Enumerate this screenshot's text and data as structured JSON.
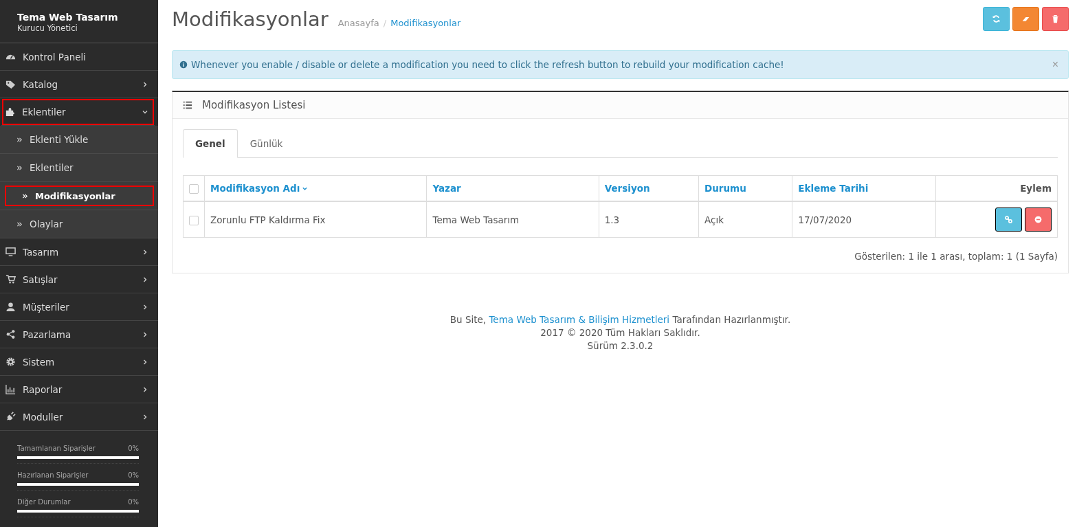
{
  "profile": {
    "name": "Tema Web Tasarım",
    "role": "Kurucu Yönetici"
  },
  "menu": [
    {
      "label": "Kontrol Paneli",
      "highlighted": false
    },
    {
      "label": "Katalog",
      "expanded": false,
      "highlighted": false
    },
    {
      "label": "Eklentiler",
      "expanded": true,
      "highlighted": true,
      "children": [
        {
          "label": "Eklenti Yükle",
          "selected": false,
          "highlighted": false
        },
        {
          "label": "Eklentiler",
          "selected": false,
          "highlighted": false
        },
        {
          "label": "Modifikasyonlar",
          "selected": true,
          "highlighted": true
        },
        {
          "label": "Olaylar",
          "selected": false,
          "highlighted": false
        }
      ]
    },
    {
      "label": "Tasarım",
      "expanded": false,
      "highlighted": false
    },
    {
      "label": "Satışlar",
      "expanded": false,
      "highlighted": false
    },
    {
      "label": "Müşteriler",
      "expanded": false,
      "highlighted": false
    },
    {
      "label": "Pazarlama",
      "expanded": false,
      "highlighted": false
    },
    {
      "label": "Sistem",
      "expanded": false,
      "highlighted": false
    },
    {
      "label": "Raporlar",
      "expanded": false,
      "highlighted": false
    },
    {
      "label": "Moduller",
      "expanded": false,
      "highlighted": false
    }
  ],
  "stats": [
    {
      "label": "Tamamlanan Siparişler",
      "value": "0%",
      "level": 0
    },
    {
      "label": "Hazırlanan Siparişler",
      "value": "0%",
      "level": 0
    },
    {
      "label": "Diğer Durumlar",
      "value": "0%",
      "level": 0
    }
  ],
  "page": {
    "title": "Modifikasyonlar",
    "breadcrumb_separator": "/",
    "breadcrumbs": [
      {
        "label": "Anasayfa",
        "current": false
      },
      {
        "label": "Modifikasyonlar",
        "current": true
      }
    ],
    "toolbar": [
      {
        "kind": "refresh"
      },
      {
        "kind": "clear"
      },
      {
        "kind": "delete"
      }
    ]
  },
  "alert": {
    "text": "Whenever you enable / disable or delete a modification you need to click the refresh button to rebuild your modification cache!",
    "close": "×"
  },
  "panel": {
    "title": "Modifikasyon Listesi",
    "all_checked": false,
    "tabs": [
      {
        "label": "Genel",
        "selected": true
      },
      {
        "label": "Günlük",
        "selected": false
      }
    ],
    "columns": [
      {
        "label": "Modifikasyon Adı",
        "sorted": true,
        "kind": "link"
      },
      {
        "label": "Yazar",
        "sorted": false,
        "kind": "link"
      },
      {
        "label": "Versiyon",
        "sorted": false,
        "kind": "link"
      },
      {
        "label": "Durumu",
        "sorted": false,
        "kind": "link"
      },
      {
        "label": "Ekleme Tarihi",
        "sorted": false,
        "kind": "link"
      },
      {
        "label": "Eylem",
        "sorted": false,
        "kind": "plain"
      }
    ],
    "rows": [
      {
        "checked": false,
        "cells": [
          "Zorunlu FTP Kaldırma Fix",
          "Tema Web Tasarım",
          "1.3",
          "Açık",
          "17/07/2020"
        ],
        "actions": [
          {
            "kind": "link"
          },
          {
            "kind": "disable"
          }
        ]
      }
    ],
    "pagination": "Gösterilen: 1 ile 1 arası, toplam: 1 (1 Sayfa)"
  },
  "footer": {
    "prefix": "Bu Site, ",
    "link": "Tema Web Tasarım & Bilişim Hizmetleri",
    "suffix": " Tarafından Hazırlanmıştır.",
    "copyright": "2017 © 2020 Tüm Hakları Saklıdır.",
    "version": "Sürüm 2.3.0.2"
  }
}
